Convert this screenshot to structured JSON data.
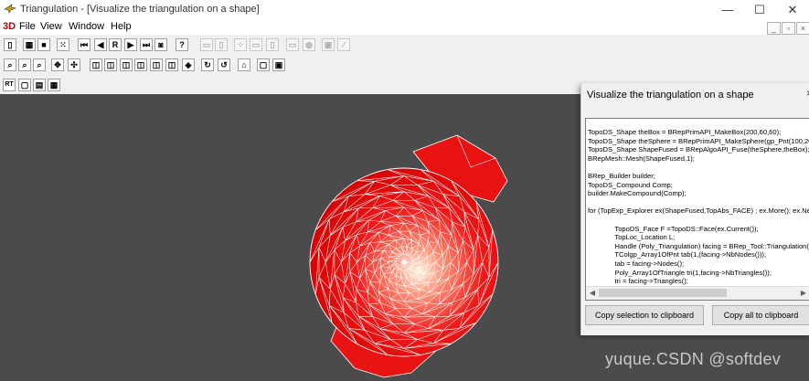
{
  "window": {
    "title": "Triangulation - [Visualize the triangulation on a shape]",
    "controls": [
      "—",
      "☐",
      "✕"
    ]
  },
  "menu": {
    "logo": "3D",
    "items": [
      "File",
      "View",
      "Window",
      "Help"
    ],
    "mdi_controls": [
      "_",
      "▫",
      "×"
    ]
  },
  "toolbars": {
    "row1": [
      {
        "icon": "new-icon",
        "glyph": "▯",
        "enabled": true
      },
      {
        "icon": "grid-icon",
        "glyph": "▦",
        "enabled": true
      },
      {
        "icon": "color-icon",
        "glyph": "■",
        "enabled": true
      },
      {
        "icon": "dots-icon",
        "glyph": "⁙",
        "enabled": true
      },
      {
        "icon": "first-icon",
        "glyph": "⏮",
        "enabled": true
      },
      {
        "icon": "prev-icon",
        "glyph": "◀",
        "enabled": true
      },
      {
        "icon": "reset-icon",
        "glyph": "R",
        "enabled": true
      },
      {
        "icon": "next-icon",
        "glyph": "▶",
        "enabled": true
      },
      {
        "icon": "last-icon",
        "glyph": "⏭",
        "enabled": true
      },
      {
        "icon": "camera-icon",
        "glyph": "◙",
        "enabled": true
      },
      {
        "icon": "help-icon",
        "glyph": "?",
        "enabled": true
      },
      {
        "icon": "copy-icon",
        "glyph": "▭",
        "enabled": false
      },
      {
        "icon": "erase-icon",
        "glyph": "▯",
        "enabled": false
      },
      {
        "icon": "points-icon",
        "glyph": "⁘",
        "enabled": false
      },
      {
        "icon": "delete-icon",
        "glyph": "▭",
        "enabled": false
      },
      {
        "icon": "trash-icon",
        "glyph": "▯",
        "enabled": false
      },
      {
        "icon": "doc-icon",
        "glyph": "▭",
        "enabled": false
      },
      {
        "icon": "settings-icon",
        "glyph": "◍",
        "enabled": false
      },
      {
        "icon": "image-icon",
        "glyph": "▣",
        "enabled": false
      },
      {
        "icon": "brush-icon",
        "glyph": "∕",
        "enabled": false
      }
    ],
    "row2": [
      {
        "icon": "zoom-window-icon",
        "glyph": "⌕",
        "enabled": true
      },
      {
        "icon": "zoom-dynamic-icon",
        "glyph": "⌕",
        "enabled": true
      },
      {
        "icon": "zoom-icon",
        "glyph": "⌕",
        "enabled": true
      },
      {
        "icon": "pan-icon",
        "glyph": "✥",
        "enabled": true
      },
      {
        "icon": "global-pan-icon",
        "glyph": "✣",
        "enabled": true
      },
      {
        "icon": "view-front-icon",
        "glyph": "◫",
        "enabled": true
      },
      {
        "icon": "view-back-icon",
        "glyph": "◫",
        "enabled": true
      },
      {
        "icon": "view-top-icon",
        "glyph": "◫",
        "enabled": true
      },
      {
        "icon": "view-bottom-icon",
        "glyph": "◫",
        "enabled": true
      },
      {
        "icon": "view-left-icon",
        "glyph": "◫",
        "enabled": true
      },
      {
        "icon": "view-right-icon",
        "glyph": "◫",
        "enabled": true
      },
      {
        "icon": "view-axo-icon",
        "glyph": "◈",
        "enabled": true
      },
      {
        "icon": "rotate-icon",
        "glyph": "↻",
        "enabled": true
      },
      {
        "icon": "rotate-xyz-icon",
        "glyph": "↺",
        "enabled": true
      },
      {
        "icon": "reset-view-icon",
        "glyph": "⌂",
        "enabled": true
      },
      {
        "icon": "hidden-line-on-icon",
        "glyph": "▢",
        "enabled": true
      },
      {
        "icon": "hidden-line-off-icon",
        "glyph": "▣",
        "enabled": true
      }
    ],
    "row3": [
      {
        "icon": "ray-tracing-icon",
        "glyph": "RT",
        "enabled": true
      },
      {
        "icon": "shadows-icon",
        "glyph": "▢",
        "enabled": true
      },
      {
        "icon": "reflections-icon",
        "glyph": "▤",
        "enabled": true
      },
      {
        "icon": "antialiasing-icon",
        "glyph": "▦",
        "enabled": true
      }
    ]
  },
  "dialog": {
    "title": "Visualize the triangulation on a shape",
    "close": "×",
    "code_lines": [
      "TopoDS_Shape theBox = BRepPrimAPI_MakeBox(200,60,60);",
      "TopoDS_Shape theSphere = BRepPrimAPI_MakeSphere(gp_Pnt(100,20,20),80);",
      "TopoDS_Shape ShapeFused = BRepAlgoAPI_Fuse(theSphere,theBox);",
      "BRepMesh::Mesh(ShapeFused,1);",
      "",
      "BRep_Builder builder;",
      "TopoDS_Compound Comp;",
      "builder.MakeCompound(Comp);",
      "",
      "for (TopExp_Explorer ex(ShapeFused,TopAbs_FACE) ; ex.More(); ex.Next()) {",
      "",
      "              TopoDS_Face F =TopoDS::Face(ex.Current());",
      "              TopLoc_Location L;",
      "              Handle (Poly_Triangulation) facing = BRep_Tool::Triangulation(F,L);",
      "              TColgp_Array1OfPnt tab(1,(facing->NbNodes()));",
      "              tab = facing->Nodes();",
      "              Poly_Array1OfTriangle tri(1,facing->NbTriangles());",
      "              tri = facing->Triangles();"
    ],
    "buttons": {
      "copy_selection": "Copy selection to clipboard",
      "copy_all": "Copy all to clipboard"
    }
  },
  "viewport": {
    "background": "#4b4b4b",
    "shape_color": "#ee1111",
    "mesh_color": "#ffffff"
  },
  "watermark": "yuque.CSDN @softdev"
}
